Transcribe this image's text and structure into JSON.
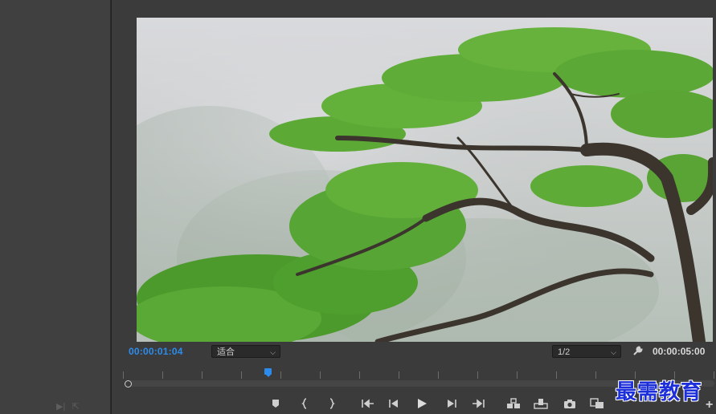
{
  "monitor": {
    "current_timecode": "00:00:01:04",
    "duration_timecode": "00:00:05:00",
    "fit_select": {
      "value": "适合"
    },
    "resolution_select": {
      "value": "1/2"
    }
  },
  "timeline": {
    "playhead_fraction": 0.24
  },
  "transport": [
    {
      "name": "add-marker-button",
      "icon": "marker-icon"
    },
    {
      "name": "mark-in-button",
      "icon": "mark-in-icon"
    },
    {
      "name": "mark-out-button",
      "icon": "mark-out-icon"
    },
    {
      "name": "go-to-in-button",
      "icon": "go-to-in-icon"
    },
    {
      "name": "step-back-button",
      "icon": "step-back-icon"
    },
    {
      "name": "play-button",
      "icon": "play-icon"
    },
    {
      "name": "step-forward-button",
      "icon": "step-forward-icon"
    },
    {
      "name": "go-to-out-button",
      "icon": "go-to-out-icon"
    },
    {
      "name": "insert-button",
      "icon": "insert-icon"
    },
    {
      "name": "overwrite-button",
      "icon": "overwrite-icon"
    },
    {
      "name": "export-frame-button",
      "icon": "camera-icon"
    },
    {
      "name": "comparison-view-button",
      "icon": "comparison-view-icon"
    }
  ],
  "watermark": {
    "text": "最需教育"
  },
  "accent_color": "#2d8ceb"
}
